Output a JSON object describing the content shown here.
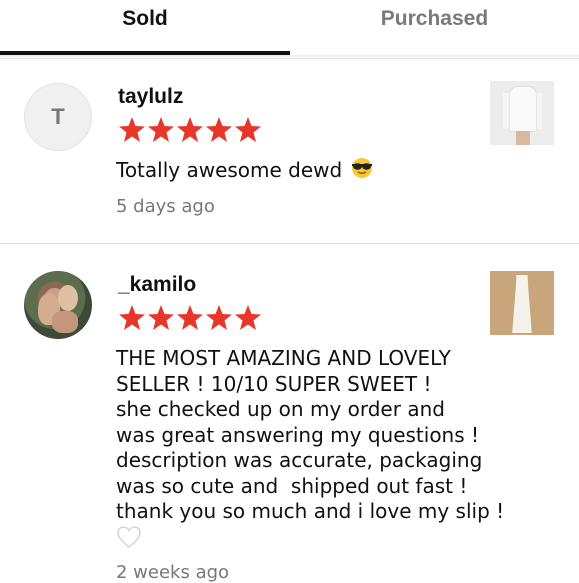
{
  "tabs": {
    "sold": "Sold",
    "purchased": "Purchased",
    "active": "sold"
  },
  "reviews": [
    {
      "avatar_initial": "T",
      "username": "taylulz",
      "rating": 5,
      "text": "Totally awesome dewd",
      "emoji_icon": "sunglasses-face-icon",
      "time": "5 days ago",
      "thumbnail": "white-long-shirt-listing-thumbnail"
    },
    {
      "avatar_initial": "",
      "username": "_kamilo",
      "rating": 5,
      "text_lines": [
        "THE MOST AMAZING AND LOVELY",
        "SELLER ! 10/10 SUPER SWEET !",
        "she checked up on my order and",
        "was great answering my questions !",
        "description was accurate, packaging",
        "was so cute and  shipped out fast !",
        "thank you so much and i love my slip !"
      ],
      "emoji_icon": "white-heart-icon",
      "time": "2 weeks ago",
      "thumbnail": "white-slip-dress-listing-thumbnail"
    }
  ],
  "colors": {
    "star": "#e8372a",
    "muted": "#777777",
    "text": "#111111"
  }
}
